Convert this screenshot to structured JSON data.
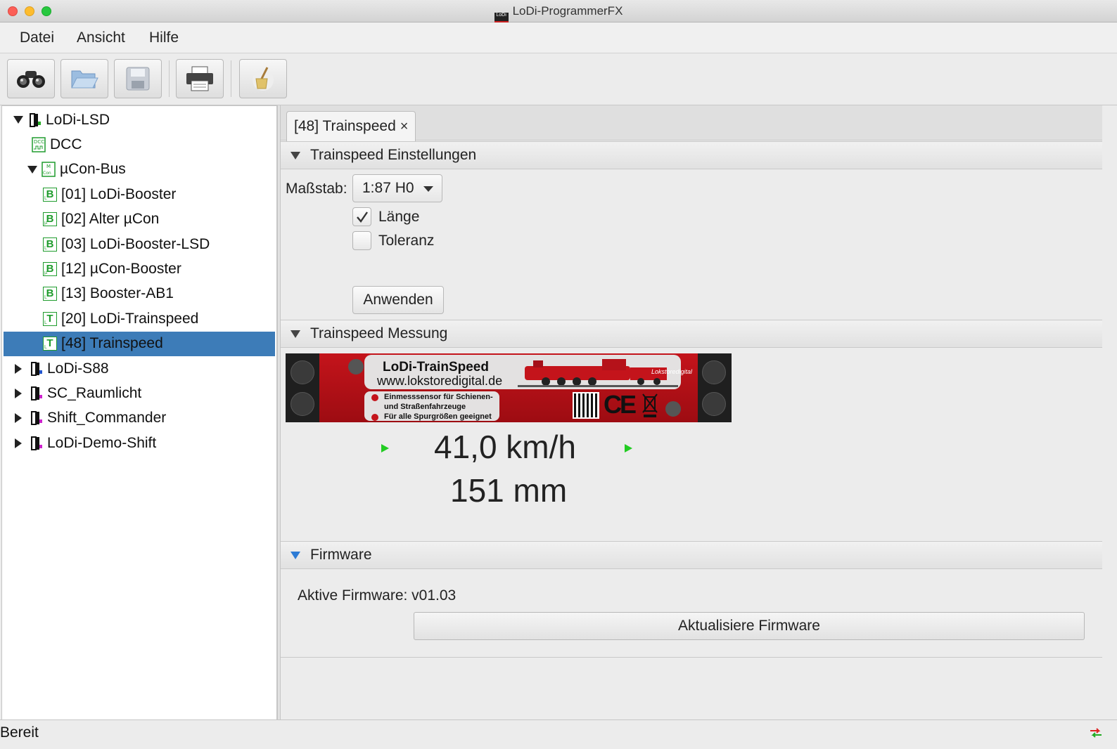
{
  "window": {
    "title": "LoDi-ProgrammerFX",
    "logo_text": "LoDi"
  },
  "menu": [
    "Datei",
    "Ansicht",
    "Hilfe"
  ],
  "toolbar": {
    "buttons": [
      {
        "name": "search-devices",
        "icon": "binoculars-icon"
      },
      {
        "name": "open-file",
        "icon": "folder-open-icon"
      },
      {
        "name": "save-file",
        "icon": "floppy-disk-icon"
      },
      {
        "name": "print",
        "icon": "printer-icon"
      },
      {
        "name": "clear",
        "icon": "broom-icon"
      }
    ]
  },
  "tree": {
    "items": [
      {
        "label": "LoDi-LSD",
        "level": 0,
        "expander": "open",
        "icon": "device-icon"
      },
      {
        "label": "DCC",
        "level": 1,
        "expander": "none",
        "icon": "dcc-icon"
      },
      {
        "label": "µCon-Bus",
        "level": 1,
        "expander": "open",
        "icon": "ucon-bus-icon"
      },
      {
        "label": "[01] LoDi-Booster",
        "level": 2,
        "expander": "none",
        "icon": "booster-icon",
        "badge": "B",
        "sub": "L"
      },
      {
        "label": "[02] Alter µCon",
        "level": 2,
        "expander": "none",
        "icon": "booster-icon",
        "badge": "B",
        "sub": "µ"
      },
      {
        "label": "[03] LoDi-Booster-LSD",
        "level": 2,
        "expander": "none",
        "icon": "booster-icon",
        "badge": "B",
        "sub": "L"
      },
      {
        "label": "[12] µCon-Booster",
        "level": 2,
        "expander": "none",
        "icon": "booster-icon",
        "badge": "B",
        "sub": "µ"
      },
      {
        "label": "[13] Booster-AB1",
        "level": 2,
        "expander": "none",
        "icon": "booster-icon",
        "badge": "B",
        "sub": "L"
      },
      {
        "label": "[20] LoDi-Trainspeed",
        "level": 2,
        "expander": "none",
        "icon": "trainspeed-icon",
        "badge": "T",
        "sub": "L"
      },
      {
        "label": "[48] Trainspeed",
        "level": 2,
        "expander": "none",
        "icon": "trainspeed-icon",
        "badge": "T",
        "sub": "L",
        "selected": true
      },
      {
        "label": "LoDi-S88",
        "level": 0,
        "expander": "closed",
        "icon": "device-icon"
      },
      {
        "label": "SC_Raumlicht",
        "level": 0,
        "expander": "closed",
        "icon": "device-icon"
      },
      {
        "label": "Shift_Commander",
        "level": 0,
        "expander": "closed",
        "icon": "device-icon"
      },
      {
        "label": "LoDi-Demo-Shift",
        "level": 0,
        "expander": "closed",
        "icon": "device-icon"
      }
    ]
  },
  "tab": {
    "label": "[48] Trainspeed",
    "close": "×"
  },
  "settings": {
    "header": "Trainspeed Einstellungen",
    "scale_label": "Maßstab:",
    "scale_value": "1:87 H0",
    "length_label": "Länge",
    "length_checked": true,
    "tolerance_label": "Toleranz",
    "tolerance_checked": false,
    "apply_label": "Anwenden"
  },
  "measurement": {
    "header": "Trainspeed Messung",
    "banner": {
      "title": "LoDi-TrainSpeed",
      "url": "www.lokstoredigital.de",
      "line1": "Einmesssensor für Schienen-",
      "line2": "und Straßenfahrzeuge",
      "line3": "Für alle Spurgrößen geeignet",
      "ce": "CE",
      "locomotive_brand": "Lokstoredigital"
    },
    "speed": "41,0 km/h",
    "distance": "151 mm"
  },
  "firmware": {
    "header": "Firmware",
    "active_label": "Aktive Firmware: v01.03",
    "update_label": "Aktualisiere Firmware"
  },
  "status": {
    "text": "Bereit",
    "icon": "connection-arrows-icon"
  },
  "colors": {
    "selection": "#3d7cb8",
    "accent_green": "#1f9c2d",
    "banner_red": "#c4141b",
    "speed_arrow": "#22cc22"
  }
}
